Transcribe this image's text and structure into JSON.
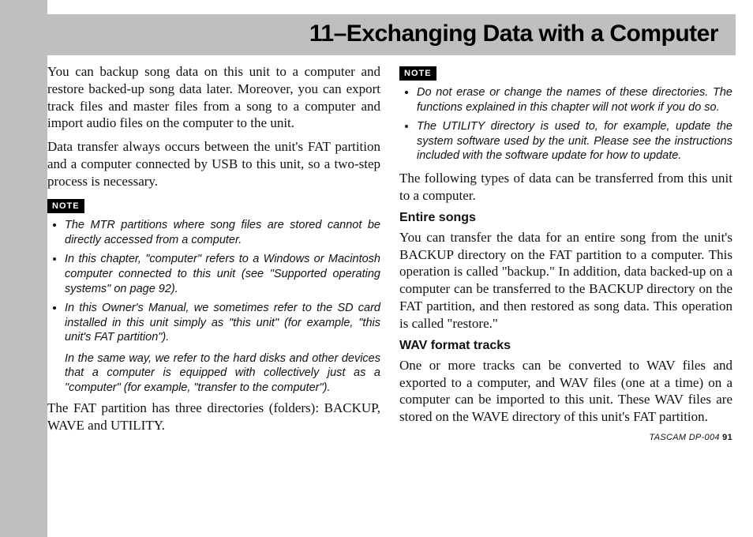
{
  "chapter": {
    "title": "11–Exchanging Data with a Computer"
  },
  "left": {
    "p1": "You can backup song data on this unit to a computer and restore backed-up song data later. Moreover, you can export track files and master files from a song to a computer and import audio files on the computer to the unit.",
    "p2": "Data transfer always occurs between the unit's FAT partition and a computer connected by USB to this unit, so a two-step process is necessary.",
    "noteLabel": "NOTE",
    "notes": {
      "n1": "The MTR partitions where song files are stored cannot be directly accessed from a computer.",
      "n2": "In this chapter, \"computer\" refers to a Windows or Macintosh computer connected to this unit (see \"Supported operating systems\" on page 92).",
      "n3": "In this Owner's Manual, we sometimes refer to the SD card installed in this unit simply as \"this unit\" (for example, \"this unit's FAT partition\").",
      "n3b": "In the same way, we refer to the hard disks and other devices that a computer is equipped with collectively just as a \"computer\" (for example, \"transfer to the computer\")."
    },
    "p3": "The FAT partition has three directories (folders): BACKUP, WAVE and UTILITY."
  },
  "right": {
    "noteLabel": "NOTE",
    "notes": {
      "n1": "Do not erase or change the names of these directories. The functions explained in this chapter will not work if you do so.",
      "n2": "The UTILITY directory is used to, for example, update the system software used by the unit. Please see the instructions included with the software update for how to update."
    },
    "p1": "The following types of data can be transferred from this unit to a computer.",
    "h1": "Entire songs",
    "p2": "You can transfer the data for an entire song from the unit's BACKUP directory on the FAT partition to a computer. This operation is called \"backup.\" In addition, data backed-up on a computer can be transferred to the BACKUP directory on the FAT partition, and then restored as song data. This operation is called \"restore.\"",
    "h2": "WAV format tracks",
    "p3": "One or more tracks can be converted to WAV files and exported to a computer, and WAV files (one at a time) on a computer can be imported to this unit. These WAV files are stored on the WAVE directory of this unit's FAT partition."
  },
  "footer": {
    "model": "TASCAM  DP-004",
    "page": "91"
  }
}
